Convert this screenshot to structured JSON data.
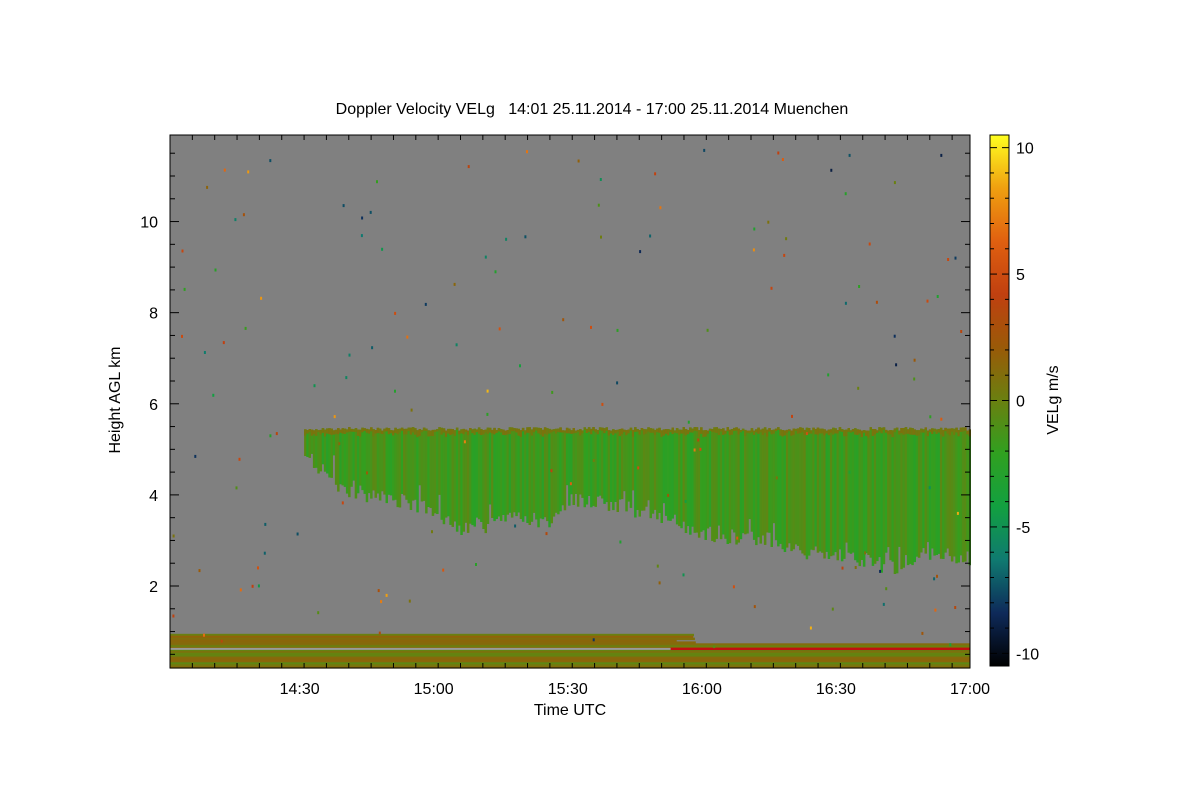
{
  "chart_data": {
    "type": "heatmap",
    "title": "Doppler Velocity VELg   14:01 25.11.2014 - 17:00 25.11.2014 Muenchen",
    "xlabel": "Time UTC",
    "ylabel": "Height AGL km",
    "xlim": [
      "14:01",
      "17:00"
    ],
    "ylim": [
      0.2,
      11.9
    ],
    "x_ticks": [
      "14:30",
      "15:00",
      "15:30",
      "16:00",
      "16:30",
      "17:00"
    ],
    "y_ticks": [
      "2",
      "4",
      "6",
      "8",
      "10"
    ],
    "colorbar": {
      "label": "VELg m/s",
      "range": [
        -10.5,
        10.5
      ],
      "ticks": [
        "10",
        "5",
        "0",
        "-5",
        "-10"
      ],
      "colors": [
        "#000000",
        "#0e2a5a",
        "#0f7a70",
        "#12a040",
        "#30a020",
        "#6a8010",
        "#9a5a08",
        "#c04010",
        "#e06010",
        "#f0a010",
        "#ffff20"
      ]
    },
    "background_color": "#808080",
    "cloud_layer": {
      "start_time": "14:31",
      "end_time": "17:00",
      "top_km": 5.45,
      "base_km_profile": [
        {
          "t": "14:31",
          "base": 4.9
        },
        {
          "t": "14:40",
          "base": 4.1
        },
        {
          "t": "14:50",
          "base": 3.9
        },
        {
          "t": "15:00",
          "base": 3.7
        },
        {
          "t": "15:05",
          "base": 3.2
        },
        {
          "t": "15:10",
          "base": 3.3
        },
        {
          "t": "15:20",
          "base": 3.5
        },
        {
          "t": "15:25",
          "base": 3.4
        },
        {
          "t": "15:30",
          "base": 3.9
        },
        {
          "t": "15:40",
          "base": 3.8
        },
        {
          "t": "15:50",
          "base": 3.5
        },
        {
          "t": "15:57",
          "base": 3.2
        },
        {
          "t": "16:05",
          "base": 3.1
        },
        {
          "t": "16:15",
          "base": 3.0
        },
        {
          "t": "16:25",
          "base": 2.7
        },
        {
          "t": "16:35",
          "base": 2.6
        },
        {
          "t": "16:42",
          "base": 2.4
        },
        {
          "t": "16:50",
          "base": 2.7
        },
        {
          "t": "17:00",
          "base": 2.6
        }
      ],
      "typical_velocity_ms": -1.5
    },
    "boundary_layer": {
      "height_km": 0.95,
      "typical_velocity_ms": 0.5
    }
  }
}
